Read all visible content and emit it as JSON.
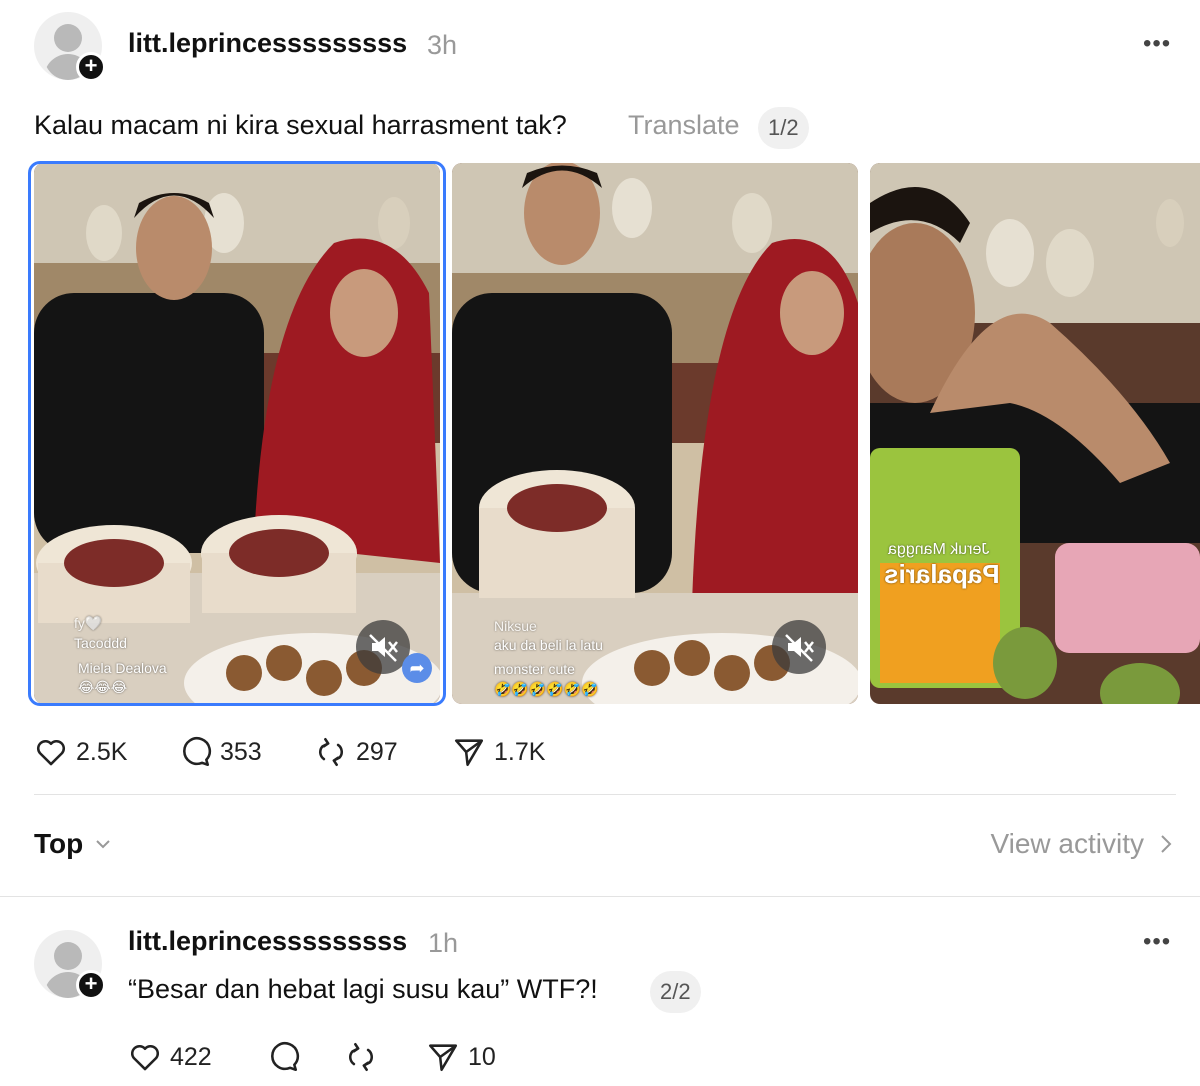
{
  "post": {
    "username": "litt.leprincesssssssss",
    "time": "3h",
    "text": "Kalau macam ni kira sexual harrasment tak?",
    "translate_label": "Translate",
    "page_indicator": "1/2",
    "media": [
      {
        "overlay": {
          "commenter1_name": "fy🤍",
          "commenter1_text": "Tacoddd",
          "commenter2_name": "Miela Dealova",
          "commenter2_text": "😂😂😂"
        }
      },
      {
        "overlay": {
          "commenter1_name": "Niksue",
          "commenter1_text": "aku da beli la latu",
          "commenter2_name": "monster cute",
          "commenter2_text": "🤣🤣🤣🤣🤣🤣"
        }
      },
      {
        "overlay": {
          "package_brand": "Jeruk Mangga",
          "package_name": "Papalaris"
        }
      }
    ],
    "actions": {
      "likes": "2.5K",
      "comments": "353",
      "reposts": "297",
      "shares": "1.7K"
    }
  },
  "thread_controls": {
    "sort_label": "Top",
    "view_activity_label": "View activity"
  },
  "reply": {
    "username": "litt.leprincesssssssss",
    "time": "1h",
    "text": "“Besar dan hebat lagi susu kau” WTF?!",
    "page_indicator": "2/2",
    "actions": {
      "likes": "422",
      "shares": "10"
    }
  },
  "icons": {
    "avatar": "default-avatar-icon",
    "follow": "plus-icon",
    "more": "more-horizontal-icon",
    "like": "heart-icon",
    "comment": "comment-bubble-icon",
    "repost": "repost-icon",
    "share": "send-icon",
    "mute": "speaker-muted-icon",
    "sort_chevron": "chevron-down-icon",
    "activity_chevron": "chevron-right-icon"
  },
  "colors": {
    "selected_outline": "#3a7bfd",
    "muted_text": "#999999",
    "text": "#111111"
  }
}
